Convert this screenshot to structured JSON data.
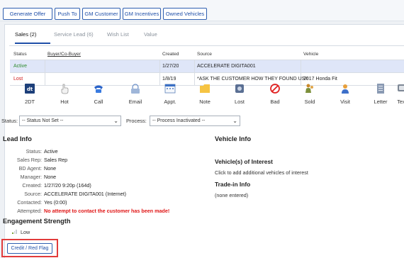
{
  "toolbar": {
    "buttons": [
      "Generate Offer",
      "Push To",
      "GM Customer",
      "GM Incentives",
      "Owned Vehicles"
    ]
  },
  "tabs": [
    "Sales (2)",
    "Service Lead (6)",
    "Wish List",
    "Value"
  ],
  "grid": {
    "headers": [
      "Status",
      "Buyer/Co-Buyer",
      "Created",
      "Source",
      "Vehicle"
    ],
    "rows": [
      {
        "status": "Active",
        "buyer": "",
        "created": "1/27/20",
        "source": "ACCELERATE DIGITA001",
        "vehicle": ""
      },
      {
        "status": "Lost",
        "buyer": "",
        "created": "1/8/19",
        "source": "*ASK THE CUSTOMER HOW THEY FOUND US!!",
        "vehicle": "2017 Honda Fit"
      }
    ]
  },
  "actions": [
    {
      "label": "2DT",
      "icon": "dt-logo-icon"
    },
    {
      "label": "Hot",
      "icon": "hand-pointer-icon"
    },
    {
      "label": "Call",
      "icon": "phone-icon"
    },
    {
      "label": "Email",
      "icon": "email-icon"
    },
    {
      "label": "Appt.",
      "icon": "calendar-icon"
    },
    {
      "label": "Note",
      "icon": "note-folder-icon"
    },
    {
      "label": "Lost",
      "icon": "lost-box-icon"
    },
    {
      "label": "Bad",
      "icon": "prohibited-icon"
    },
    {
      "label": "Sold",
      "icon": "sold-people-icon"
    },
    {
      "label": "Visit",
      "icon": "person-visit-icon"
    },
    {
      "label": "Letter",
      "icon": "letter-document-icon"
    },
    {
      "label": "Text",
      "icon": "text-bubble-icon"
    }
  ],
  "filters": {
    "status_label": "Status:",
    "status_value": "-- Status Not Set --",
    "process_label": "Process:",
    "process_value": "-- Process Inactivated --"
  },
  "lead_info": {
    "title": "Lead Info",
    "fields": [
      {
        "k": "Status:",
        "v": "Active"
      },
      {
        "k": "Sales Rep:",
        "v": "Sales Rep"
      },
      {
        "k": "BD Agent:",
        "v": "None"
      },
      {
        "k": "Manager:",
        "v": "None"
      },
      {
        "k": "Created:",
        "v": "1/27/20 9:20p (164d)"
      },
      {
        "k": "Source:",
        "v": "ACCELERATE DIGITA001 (Internet)"
      },
      {
        "k": "Contacted:",
        "v": "Yes (0:00)"
      },
      {
        "k": "Attempted:",
        "v": "No attempt to contact the customer has been made!"
      }
    ]
  },
  "vehicle_info": {
    "title": "Vehicle Info",
    "interest_title": "Vehicle(s) of Interest",
    "interest_text": "Click to add additional vehicles of interest",
    "trade_title": "Trade-in Info",
    "trade_text": "(none entered)"
  },
  "engagement": {
    "title": "Engagement Strength",
    "level": "Low"
  },
  "credit_button": "Credit / Red Flag",
  "colors": {
    "accent": "#1f4fa8",
    "active": "#2e8b2e",
    "lost": "#d11a1a",
    "highlight": "#e23b3b",
    "selected_row": "#dfe6f8"
  }
}
